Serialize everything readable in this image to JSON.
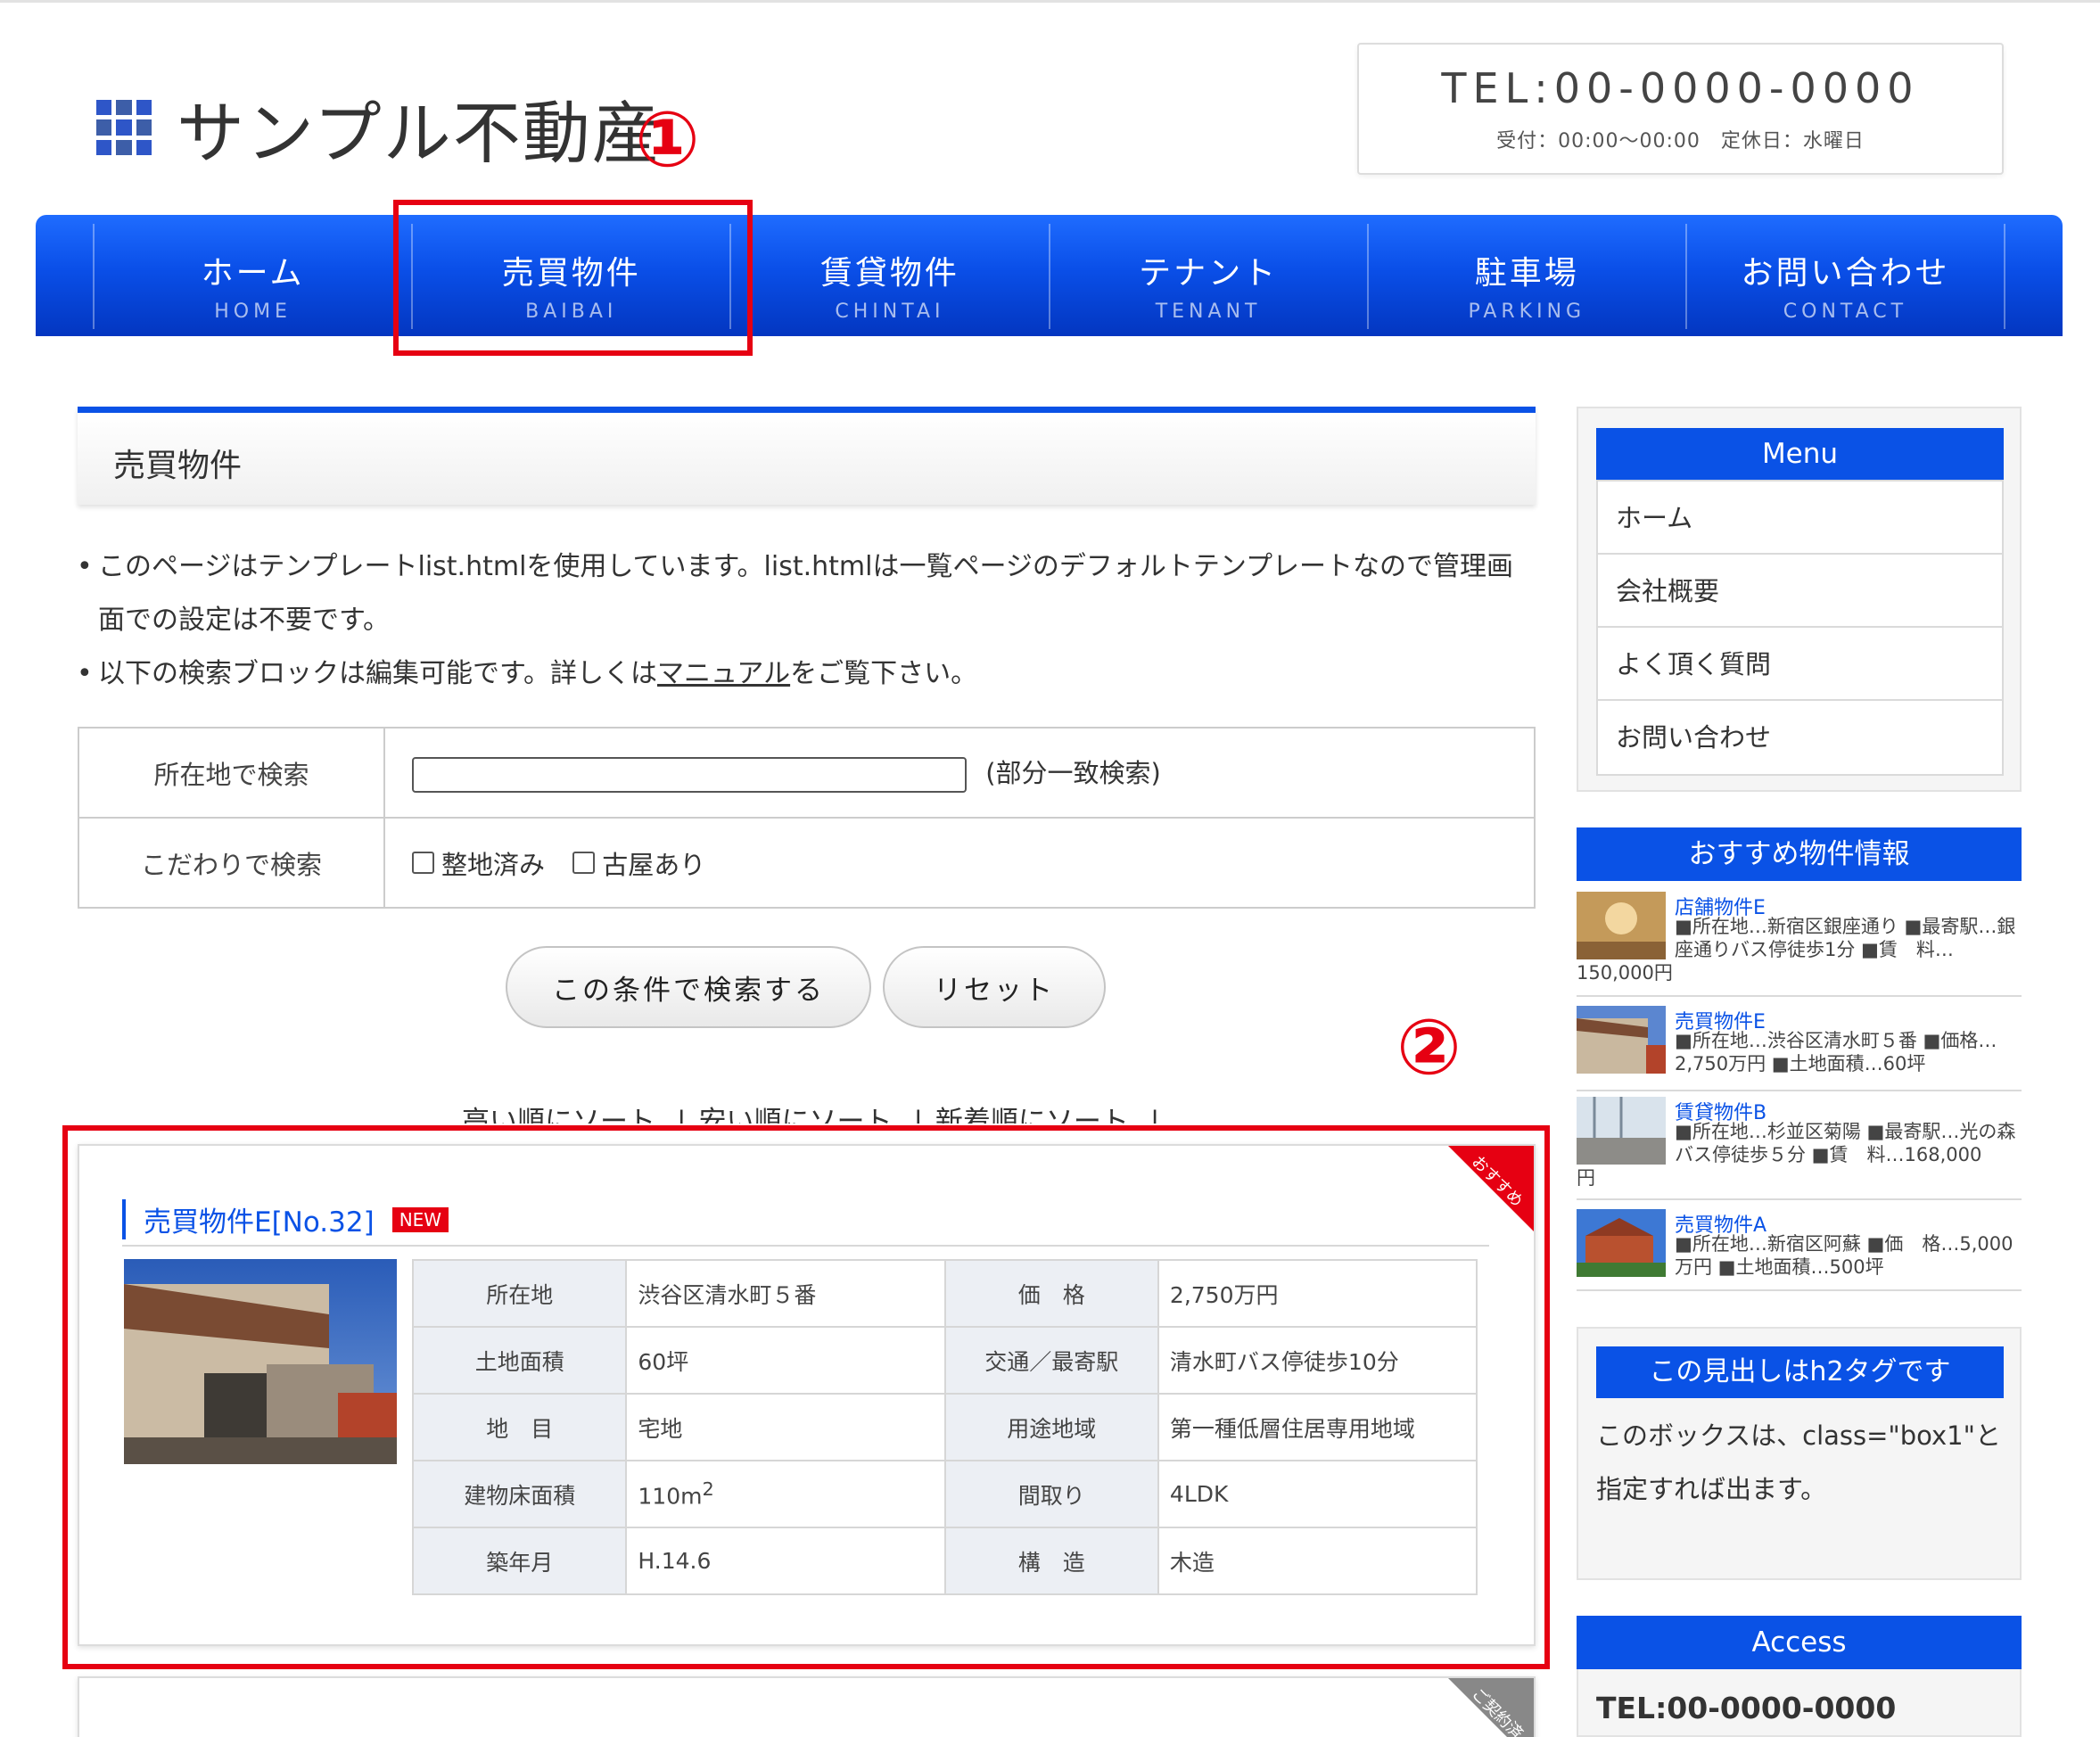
{
  "site": {
    "title": "サンプル不動産"
  },
  "header": {
    "tel": "TEL:00-0000-0000",
    "hours": "受付：00:00〜00:00　定休日：水曜日"
  },
  "nav": [
    {
      "jp": "ホーム",
      "en": "HOME"
    },
    {
      "jp": "売買物件",
      "en": "BAIBAI"
    },
    {
      "jp": "賃貸物件",
      "en": "CHINTAI"
    },
    {
      "jp": "テナント",
      "en": "TENANT"
    },
    {
      "jp": "駐車場",
      "en": "PARKING"
    },
    {
      "jp": "お問い合わせ",
      "en": "CONTACT"
    }
  ],
  "annotations": {
    "one": "①",
    "two": "②"
  },
  "page": {
    "title": "売買物件",
    "note1": "このページはテンプレートlist.htmlを使用しています。list.htmlは一覧ページのデフォルトテンプレートなので管理画面での設定は不要です。",
    "note2_pre": "以下の検索ブロックは編集可能です。詳しくは",
    "note2_link": "マニュアル",
    "note2_post": "をご覧下さい。"
  },
  "search": {
    "location_label": "所在地で検索",
    "location_value": "",
    "location_hint": "(部分一致検索)",
    "feature_label": "こだわりで検索",
    "opt1": "整地済み",
    "opt2": "古屋あり",
    "submit": "この条件で検索する",
    "reset": "リセット"
  },
  "sort": {
    "high": "高い順にソート",
    "low": "安い順にソート",
    "new": "新着順にソート",
    "sep": "|"
  },
  "listing": {
    "ribbon": "おすすめ",
    "title": "売買物件E[No.32]",
    "badge": "NEW",
    "rows": [
      {
        "k1": "所在地",
        "v1": "渋谷区清水町５番",
        "k2": "価　格",
        "v2": "2,750万円"
      },
      {
        "k1": "土地面積",
        "v1": "60坪",
        "k2": "交通／最寄駅",
        "v2": "清水町バス停徒歩10分"
      },
      {
        "k1": "地　目",
        "v1": "宅地",
        "k2": "用途地域",
        "v2": "第一種低層住居専用地域"
      },
      {
        "k1": "建物床面積",
        "v1": "110m",
        "v1sup": "2",
        "k2": "間取り",
        "v2": "4LDK"
      },
      {
        "k1": "築年月",
        "v1": "H.14.6",
        "k2": "構　造",
        "v2": "木造"
      }
    ]
  },
  "listing2": {
    "ribbon": "ご契約済"
  },
  "sidebar": {
    "menu_title": "Menu",
    "menu": [
      "ホーム",
      "会社概要",
      "よく頂く質問",
      "お問い合わせ"
    ],
    "rec_title": "おすすめ物件情報",
    "rec": [
      {
        "name": "店舗物件E",
        "desc": "■所在地…新宿区銀座通り ■最寄駅…銀座通りバス停徒歩1分 ■賃　料…",
        "tail": "150,000円"
      },
      {
        "name": "売買物件E",
        "desc": "■所在地…渋谷区清水町５番 ■価格…2,750万円 ■土地面積…60坪",
        "tail": ""
      },
      {
        "name": "賃貸物件B",
        "desc": "■所在地…杉並区菊陽 ■最寄駅…光の森バス停徒歩５分 ■賃　料…168,000",
        "tail": "円"
      },
      {
        "name": "売買物件A",
        "desc": "■所在地…新宿区阿蘇 ■価　格…5,000万円 ■土地面積…500坪",
        "tail": ""
      }
    ],
    "box1_title": "この見出しはh2タグです",
    "box1_text": "このボックスは、class=\"box1\"と指定すれば出ます。",
    "access_title": "Access",
    "access_tel": "TEL:00-0000-0000"
  }
}
